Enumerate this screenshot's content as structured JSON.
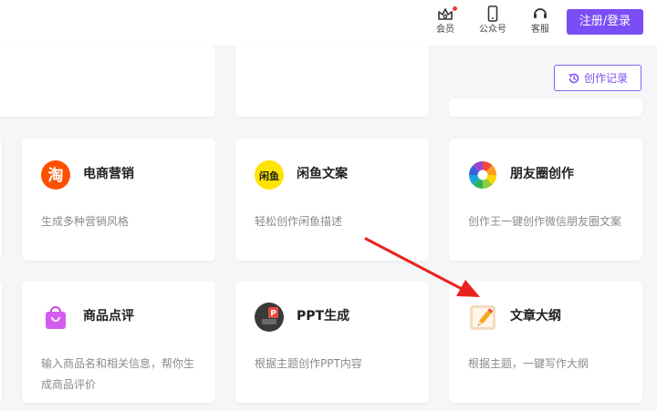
{
  "topbar": {
    "member_label": "会员",
    "official_label": "公众号",
    "service_label": "客服",
    "login_button": "注册/登录"
  },
  "toolbar": {
    "history_button": "创作记录"
  },
  "cards": [
    {
      "title": "电商营销",
      "desc": "生成多种营销风格",
      "icon": "taobao-icon"
    },
    {
      "title": "闲鱼文案",
      "desc": "轻松创作闲鱼描述",
      "icon": "xianyu-icon"
    },
    {
      "title": "朋友圈创作",
      "desc": "创作王一键创作微信朋友圈文案",
      "icon": "moments-icon"
    },
    {
      "title": "商品点评",
      "desc": "输入商品名和相关信息，帮你生成商品评价",
      "icon": "shopping-bag-icon"
    },
    {
      "title": "PPT生成",
      "desc": "根据主题创作PPT内容",
      "icon": "ppt-icon"
    },
    {
      "title": "文章大纲",
      "desc": "根据主题，一键写作大纲",
      "icon": "notepad-icon"
    }
  ],
  "colors": {
    "accent": "#7b4ef5",
    "annotation_arrow": "#e8241c"
  }
}
